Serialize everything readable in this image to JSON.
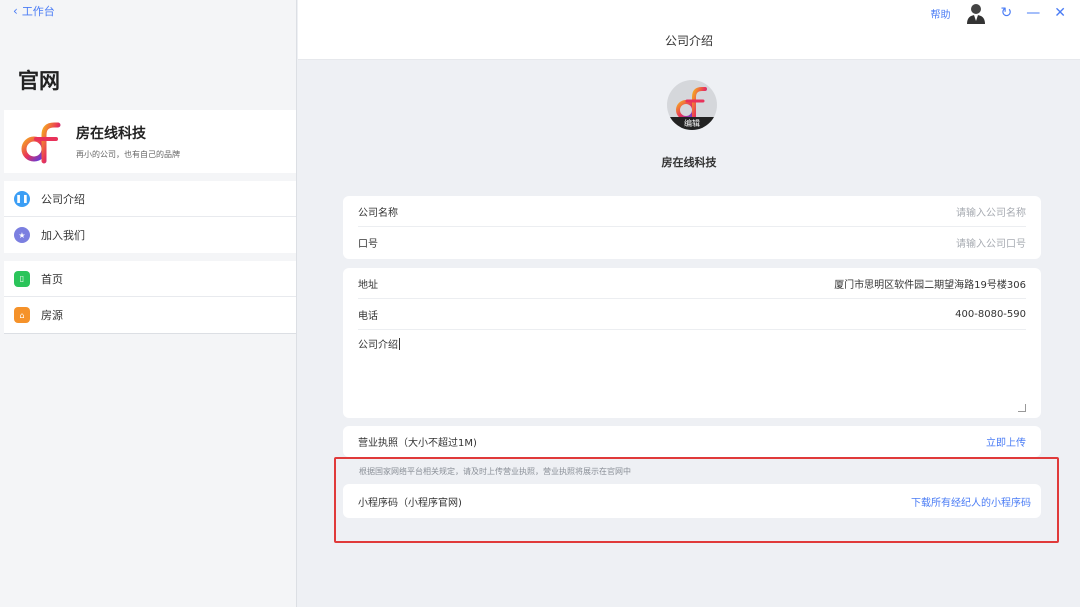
{
  "nav": {
    "back_label": "工作台"
  },
  "sidebar": {
    "title": "官网",
    "brand": {
      "name": "房在线科技",
      "slogan": "再小的公司，也有自己的品牌"
    },
    "groups": [
      [
        {
          "label": "公司介绍",
          "icon": "pause-circle-icon",
          "color": "#3b9ef5"
        },
        {
          "label": "加入我们",
          "icon": "star-circle-icon",
          "color": "#7b7fe0"
        }
      ],
      [
        {
          "label": "首页",
          "icon": "phone-icon",
          "color": "#2bc45a"
        },
        {
          "label": "房源",
          "icon": "home-icon",
          "color": "#f5922a"
        }
      ]
    ]
  },
  "header": {
    "title": "公司介绍",
    "help": "帮助"
  },
  "company": {
    "name": "房在线科技",
    "edit_label": "编辑"
  },
  "form": {
    "name_label": "公司名称",
    "name_placeholder": "请输入公司名称",
    "slogan_label": "口号",
    "slogan_placeholder": "请输入公司口号",
    "address_label": "地址",
    "address_value": "厦门市思明区软件园二期望海路19号楼306",
    "phone_label": "电话",
    "phone_value": "400-8080-590",
    "intro_label": "公司介绍",
    "license_label": "营业执照（大小不超过1M)",
    "license_action": "立即上传",
    "notice": "根据国家网络平台相关规定，请及时上传营业执照，营业执照将展示在官网中",
    "qrcode_label": "小程序码（小程序官网)",
    "qrcode_action": "下载所有经纪人的小程序码"
  },
  "colors": {
    "accent": "#4a7cf5",
    "highlight": "#e03a3a"
  }
}
